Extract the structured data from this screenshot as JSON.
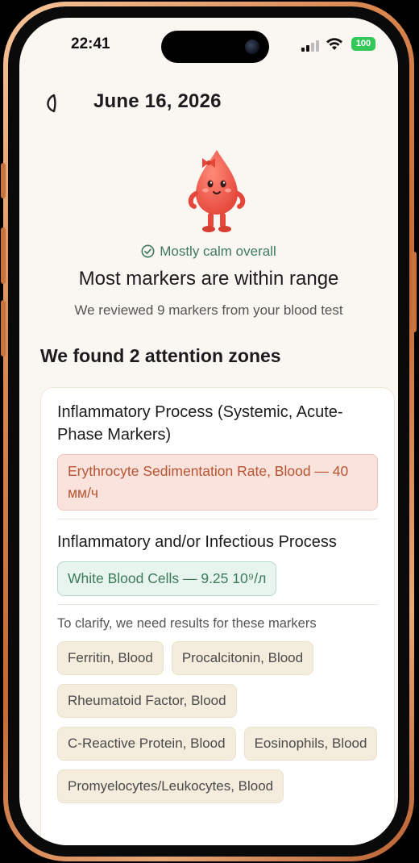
{
  "status_bar": {
    "time": "22:41",
    "battery": "100"
  },
  "header": {
    "date": "June 16, 2026"
  },
  "summary": {
    "status_text": "Mostly calm overall",
    "headline": "Most markers are within range",
    "subline": "We reviewed 9 markers from your blood test"
  },
  "zones": {
    "title": "We found 2 attention zones",
    "items": [
      {
        "title": "Inflammatory Process (Systemic, Acute-Phase Markers)",
        "marker": "Erythrocyte Sedimentation Rate, Blood — 40 мм/ч"
      },
      {
        "title": "Inflammatory and/or Infectious Process",
        "marker": "White Blood Cells — 9.25 10⁹/л"
      }
    ],
    "clarify_text": "To clarify, we need results for these markers",
    "needed_markers": [
      "Ferritin, Blood",
      "Procalcitonin, Blood",
      "Rheumatoid Factor, Blood",
      "C-Reactive Protein, Blood",
      "Eosinophils, Blood",
      "Promyelocytes/Leukocytes, Blood"
    ]
  },
  "colors": {
    "status_green": "#3d7a5a",
    "alert_red": "#b65432",
    "battery_green": "#34c759",
    "frame_copper": "#c46a34"
  }
}
